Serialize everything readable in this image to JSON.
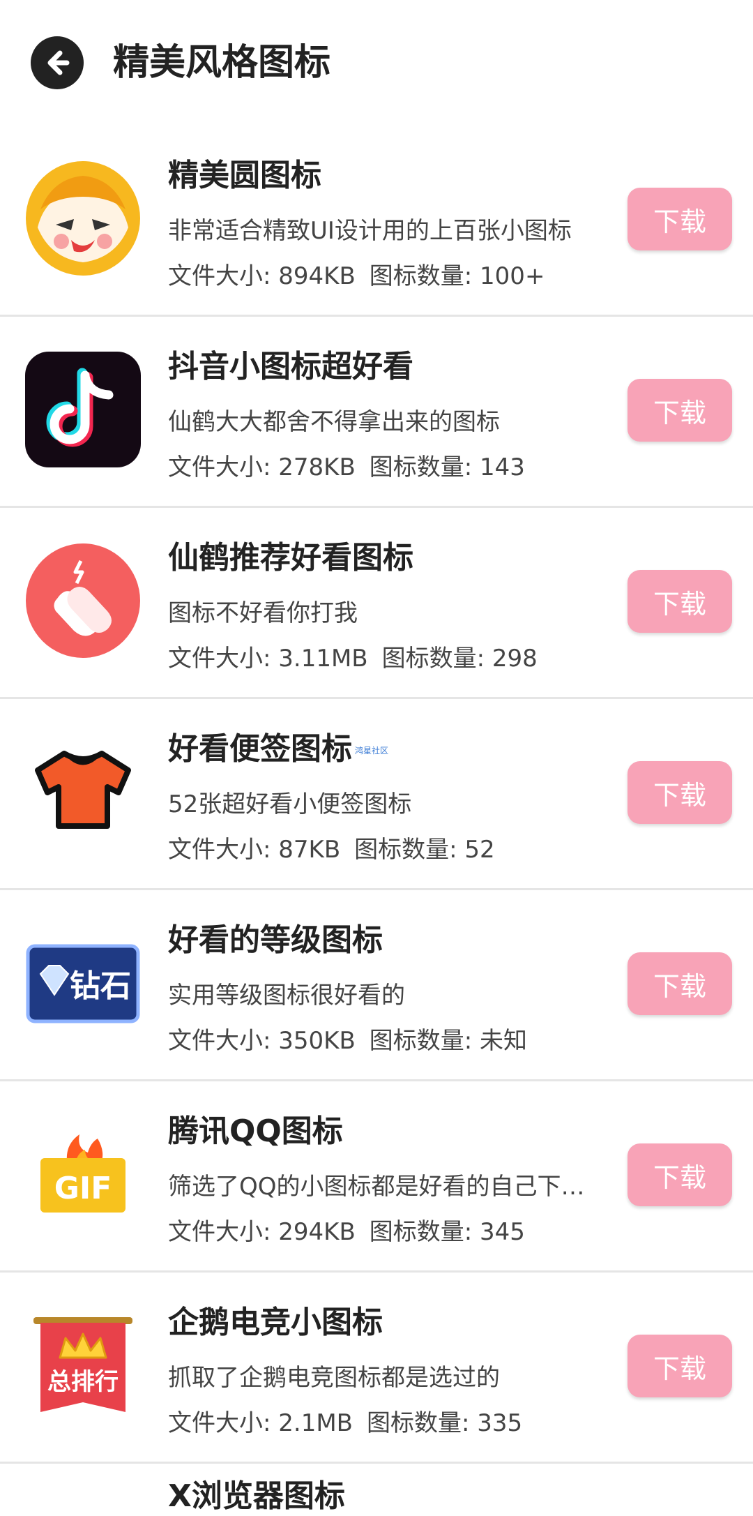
{
  "header": {
    "title": "精美风格图标"
  },
  "watermark": "鸿星社区",
  "items": [
    {
      "title": "精美圆图标",
      "desc": "非常适合精致UI设计用的上百张小图标",
      "size": "文件大小: 894KB",
      "count": "图标数量: 100+",
      "button": "下载",
      "icon": "fox-mascot-icon"
    },
    {
      "title": "抖音小图标超好看",
      "desc": "仙鹤大大都舍不得拿出来的图标",
      "size": "文件大小: 278KB",
      "count": "图标数量: 143",
      "button": "下载",
      "icon": "tiktok-icon"
    },
    {
      "title": "仙鹤推荐好看图标",
      "desc": "图标不好看你打我",
      "size": "文件大小: 3.11MB",
      "count": "图标数量: 298",
      "button": "下载",
      "icon": "clap-hands-icon"
    },
    {
      "title": "好看便签图标",
      "desc": "52张超好看小便签图标",
      "size": "文件大小: 87KB",
      "count": "图标数量: 52",
      "button": "下载",
      "icon": "tshirt-icon"
    },
    {
      "title": "好看的等级图标",
      "desc": "实用等级图标很好看的",
      "size": "文件大小: 350KB",
      "count": "图标数量: 未知",
      "button": "下载",
      "icon": "diamond-badge-icon",
      "badge_text": "钻石"
    },
    {
      "title": "腾讯QQ图标",
      "desc": "筛选了QQ的小图标都是好看的自己下载吧",
      "size": "文件大小: 294KB",
      "count": "图标数量: 345",
      "button": "下载",
      "icon": "gif-fire-icon",
      "badge_text": "GIF"
    },
    {
      "title": "企鹅电竞小图标",
      "desc": "抓取了企鹅电竞图标都是选过的",
      "size": "文件大小: 2.1MB",
      "count": "图标数量: 335",
      "button": "下载",
      "icon": "ranking-banner-icon",
      "badge_text": "总排行"
    }
  ],
  "partial_item": {
    "title": "X浏览器图标"
  },
  "colors": {
    "button_bg": "#f8a3b7",
    "divider": "#e5e5e5",
    "text": "#222222"
  }
}
